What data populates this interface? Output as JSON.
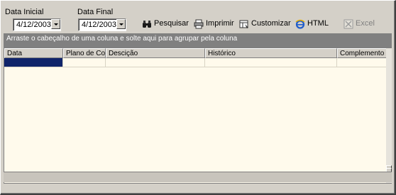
{
  "filters": {
    "start": {
      "label": "Data Inicial",
      "value": "4/12/2003"
    },
    "end": {
      "label": "Data Final",
      "value": "4/12/2003"
    }
  },
  "toolbar": {
    "search": {
      "label": "Pesquisar",
      "icon": "binoculars-icon"
    },
    "print": {
      "label": "Imprimir",
      "icon": "printer-icon"
    },
    "customize": {
      "label": "Customizar",
      "icon": "customize-icon"
    },
    "html": {
      "label": "HTML",
      "icon": "internet-explorer-icon"
    },
    "excel": {
      "label": "Excel",
      "icon": "excel-icon",
      "enabled": false
    }
  },
  "group_hint": "Arraste o cabeçalho de uma coluna e solte aqui para agrupar pela coluna",
  "grid": {
    "columns": [
      "Data",
      "Plano de Conta",
      "Descição",
      "Histórico",
      "Complemento"
    ],
    "selection_color": "#10246a",
    "background": "#fffaec"
  }
}
